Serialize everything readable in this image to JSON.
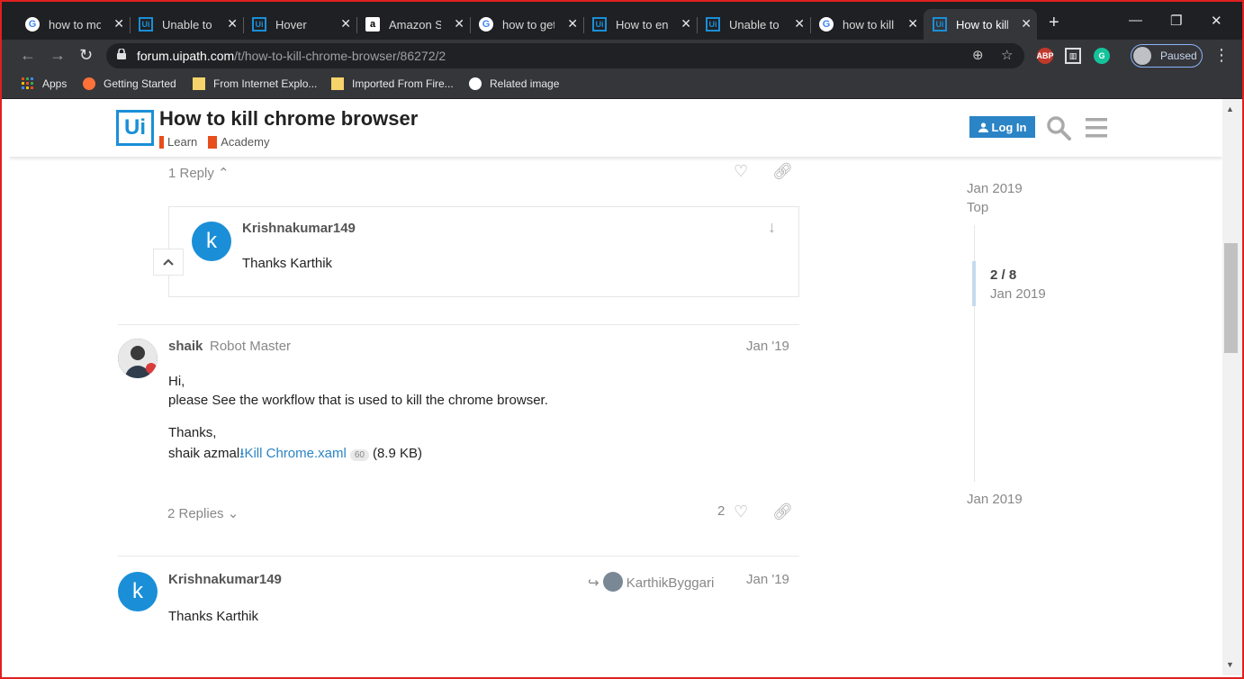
{
  "browser": {
    "tabs": [
      {
        "title": "how to mo",
        "favicon": "google-icon",
        "x": 0
      },
      {
        "title": "Unable to c",
        "favicon": "uipath-icon"
      },
      {
        "title": "Hover",
        "favicon": "uipath-icon"
      },
      {
        "title": "Amazon Sig",
        "favicon": "amazon-icon"
      },
      {
        "title": "how to get",
        "favicon": "google-icon"
      },
      {
        "title": "How to ent",
        "favicon": "uipath-icon"
      },
      {
        "title": "Unable to f",
        "favicon": "uipath-icon"
      },
      {
        "title": "how to kill",
        "favicon": "google-icon"
      },
      {
        "title": "How to kill",
        "favicon": "uipath-icon",
        "active": true
      }
    ],
    "url_host": "forum.uipath.com",
    "url_path": "/t/how-to-kill-chrome-browser/86272/2",
    "profile_label": "Paused",
    "bookmarks": [
      "Apps",
      "Getting Started",
      "From Internet Explo...",
      "Imported From Fire...",
      "Related image"
    ]
  },
  "site": {
    "logo_text": "Ui",
    "topic_title": "How to kill chrome browser",
    "categories": [
      "Learn",
      "Academy"
    ],
    "login_label": "Log In",
    "accent": "#2b84c5",
    "category_color": "#e84e1c"
  },
  "posts": {
    "prev_reply_label": "1 Reply",
    "embedded": {
      "avatar_letter": "k",
      "username": "Krishnakumar149",
      "text": "Thanks Karthik"
    },
    "shaik": {
      "username": "shaik",
      "title": "Robot Master",
      "date": "Jan '19",
      "line1": "Hi,",
      "line2": "please See the workflow that is used to kill the chrome browser.",
      "line3": "Thanks,",
      "sig": "shaik azmal",
      "file": "Kill Chrome.xaml",
      "downloads": "60",
      "size": "(8.9 KB)",
      "replies_label": "2 Replies",
      "likes": "2"
    },
    "krishna": {
      "avatar_letter": "k",
      "username": "Krishnakumar149",
      "reply_to": "KarthikByggari",
      "date": "Jan '19",
      "text": "Thanks Karthik"
    }
  },
  "timeline": {
    "start_date": "Jan 2019",
    "top_label": "Top",
    "position": "2 / 8",
    "position_date": "Jan 2019",
    "end_date": "Jan 2019"
  }
}
